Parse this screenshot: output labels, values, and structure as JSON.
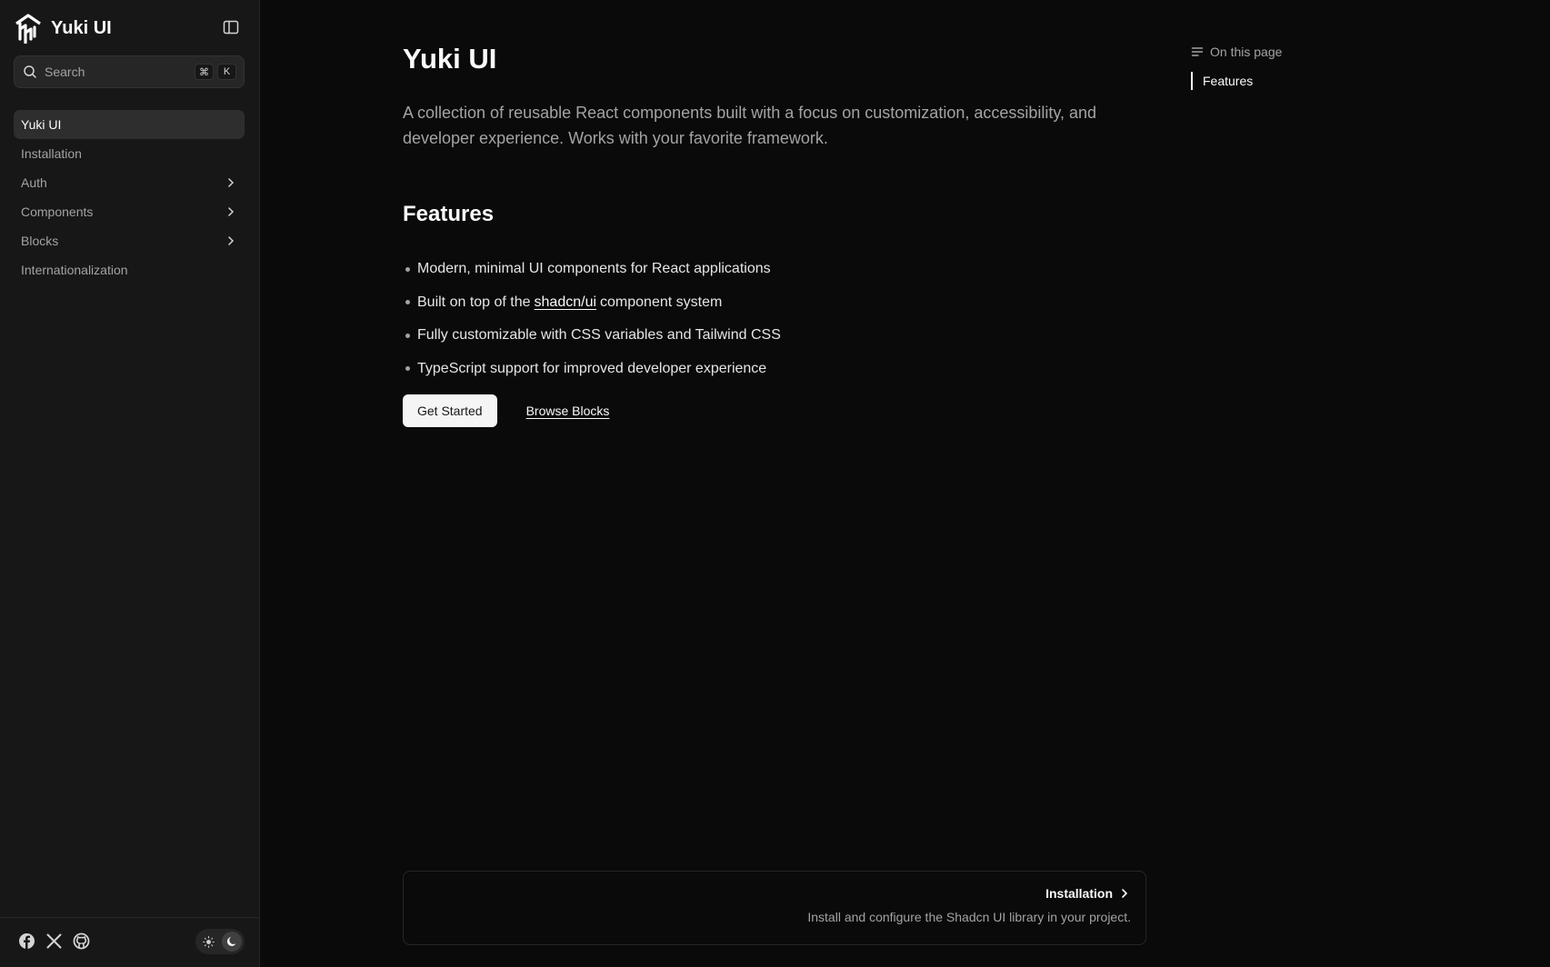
{
  "sidebar": {
    "brand": "Yuki UI",
    "search": {
      "label": "Search",
      "kbd_cmd": "⌘",
      "kbd_key": "K"
    },
    "items": [
      {
        "label": "Yuki UI",
        "active": true,
        "expandable": false
      },
      {
        "label": "Installation",
        "active": false,
        "expandable": false
      },
      {
        "label": "Auth",
        "active": false,
        "expandable": true
      },
      {
        "label": "Components",
        "active": false,
        "expandable": true
      },
      {
        "label": "Blocks",
        "active": false,
        "expandable": true
      },
      {
        "label": "Internationalization",
        "active": false,
        "expandable": false
      }
    ],
    "social_icons": [
      "facebook-icon",
      "x-icon",
      "github-icon"
    ],
    "theme": {
      "options": [
        "sun-icon",
        "moon-icon"
      ],
      "selected": "dark"
    }
  },
  "main": {
    "title": "Yuki UI",
    "lead": "A collection of reusable React components built with a focus on customization, accessibility, and developer experience. Works with your favorite framework.",
    "features_heading": "Features",
    "features": {
      "item1": "Modern, minimal UI components for React applications",
      "item2_before": "Built on top of the",
      "item2_link": "shadcn/ui",
      "item2_after": "component system",
      "item3": "Fully customizable with CSS variables and Tailwind CSS",
      "item4": "TypeScript support for improved developer experience"
    },
    "primary_button": "Get Started",
    "secondary_link": "Browse Blocks",
    "next_page": {
      "title": "Installation",
      "description": "Install and configure the Shadcn UI library in your project."
    }
  },
  "toc": {
    "heading": "On this page",
    "links": [
      "Features"
    ]
  },
  "colors": {
    "background": "#0a0a0a",
    "sidebar": "#171717",
    "text": "#fafafa",
    "muted": "#a3a3a3"
  }
}
